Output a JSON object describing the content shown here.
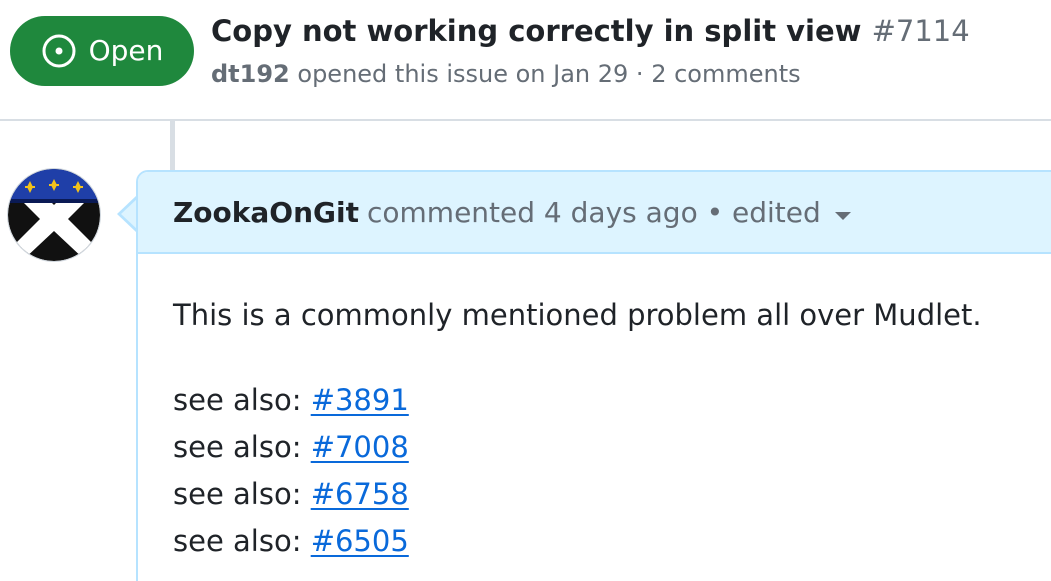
{
  "issue": {
    "state_label": "Open",
    "title": "Copy not working correctly in split view",
    "number": "#7114",
    "author": "dt192",
    "opened_text": "opened this issue on Jan 29 · 2 comments"
  },
  "comment": {
    "author": "ZookaOnGit",
    "action_text": "commented 4 days ago • edited",
    "body_paragraph": "This is a commonly mentioned problem all over Mudlet.",
    "see_also": [
      {
        "prefix": "see also:",
        "link": "#3891"
      },
      {
        "prefix": "see also:",
        "link": "#7008"
      },
      {
        "prefix": "see also:",
        "link": "#6758"
      },
      {
        "prefix": "see also:",
        "link": "#6505"
      }
    ]
  },
  "icons": {
    "state": "issue-opened-icon",
    "edit_menu": "chevron-down-icon",
    "avatar": "avatar"
  },
  "colors": {
    "open_green": "#1f883d",
    "comment_header_bg": "#ddf4ff",
    "comment_border": "#b6e3ff",
    "link_blue": "#0969da",
    "muted_text": "#656d76"
  }
}
